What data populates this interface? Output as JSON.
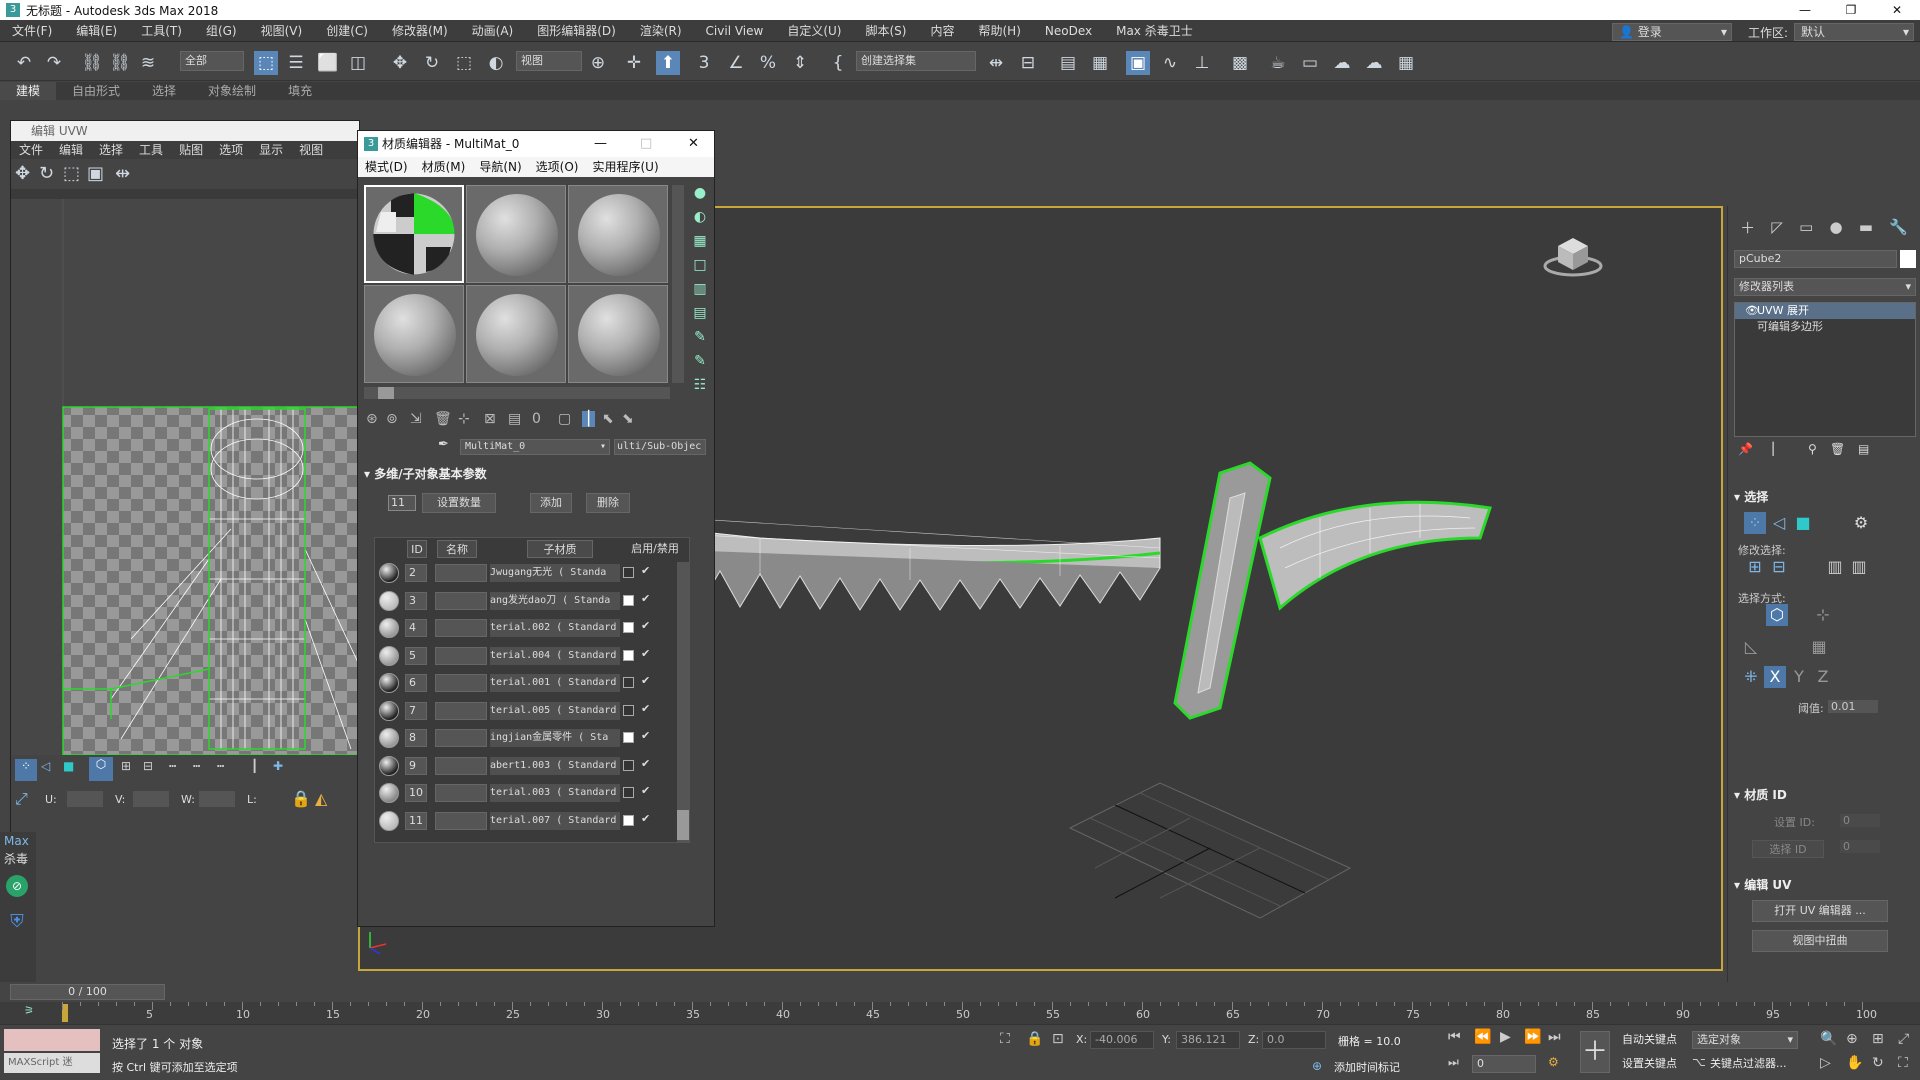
{
  "window": {
    "title": "无标题 - Autodesk 3ds Max 2018",
    "min": "—",
    "max": "❐",
    "close": "✕"
  },
  "menu": [
    "文件(F)",
    "编辑(E)",
    "工具(T)",
    "组(G)",
    "视图(V)",
    "创建(C)",
    "修改器(M)",
    "动画(A)",
    "图形编辑器(D)",
    "渲染(R)",
    "Civil View",
    "自定义(U)",
    "脚本(S)",
    "内容",
    "帮助(H)",
    "NeoDex",
    "Max 杀毒卫士"
  ],
  "login": "登录",
  "workspace": {
    "label": "工作区:",
    "value": "默认"
  },
  "toolbar": {
    "filter": "全部",
    "ref_coord": "视图",
    "named_selection": "创建选择集"
  },
  "ribbon_tabs": [
    "建模",
    "自由形式",
    "选择",
    "对象绘制",
    "填充"
  ],
  "uvw_editor": {
    "title": "编辑 UVW",
    "menu": [
      "文件",
      "编辑",
      "选择",
      "工具",
      "贴图",
      "选项",
      "显示",
      "视图"
    ],
    "u_label": "U:",
    "v_label": "V:",
    "w_label": "W:",
    "l_label": "L:"
  },
  "left_strip": {
    "max_label": "Max",
    "antivirus_label": "杀毒"
  },
  "material_editor": {
    "title": "材质编辑器 - MultiMat_0",
    "menu": [
      "模式(D)",
      "材质(M)",
      "导航(N)",
      "选项(O)",
      "实用程序(U)"
    ],
    "mat_name": "MultiMat_0",
    "mat_type": "ulti/Sub-Objec",
    "rollout_title": "多维/子对象基本参数",
    "count": "11",
    "set_count": "设置数量",
    "add": "添加",
    "delete": "删除",
    "columns": {
      "id": "ID",
      "name": "名称",
      "sub": "子材质",
      "enable": "启用/禁用"
    },
    "rows": [
      {
        "id": "2",
        "sub": "Jwugang无光  ( Standa",
        "ball": "#222",
        "color": "#333"
      },
      {
        "id": "3",
        "sub": "ang发光dao刀  ( Standa",
        "ball": "#bbb",
        "color": "#ffffff"
      },
      {
        "id": "4",
        "sub": "terial.002  ( Standard",
        "ball": "#999",
        "color": "#ffffff"
      },
      {
        "id": "5",
        "sub": "terial.004  ( Standard",
        "ball": "#999",
        "color": "#ffffff"
      },
      {
        "id": "6",
        "sub": "terial.001  ( Standard",
        "ball": "#222",
        "color": "#333"
      },
      {
        "id": "7",
        "sub": "terial.005  ( Standard",
        "ball": "#222",
        "color": "#333"
      },
      {
        "id": "8",
        "sub": "ingjian金属零件  ( Sta",
        "ball": "#999",
        "color": "#ffffff"
      },
      {
        "id": "9",
        "sub": "abert1.003  ( Standard",
        "ball": "#222",
        "color": "#333"
      },
      {
        "id": "10",
        "sub": "terial.003  ( Standard",
        "ball": "#888",
        "color": "#333"
      },
      {
        "id": "11",
        "sub": "terial.007  ( Standard",
        "ball": "#bbb",
        "color": "#ffffff"
      }
    ],
    "check": "✔"
  },
  "command_panel": {
    "object_name": "pCube2",
    "modifier_list": "修改器列表",
    "stack": [
      "UVW 展开",
      "可编辑多边形"
    ],
    "selection_title": "选择",
    "modify_selection": "修改选择:",
    "select_by": "选择方式:",
    "threshold_label": "阈值:",
    "threshold_value": "0.01",
    "matid_title": "材质 ID",
    "set_id": "设置 ID:",
    "set_id_val": "0",
    "select_id": "选择 ID",
    "select_id_val": "0",
    "edit_uv_title": "编辑 UV",
    "open_uv_editor": "打开 UV 编辑器 ...",
    "tweak_in_view": "视图中扭曲",
    "axis_x": "X",
    "axis_y": "Y",
    "axis_z": "Z"
  },
  "timeline": {
    "frame": "0 / 100",
    "ticks": [
      "5",
      "10",
      "15",
      "20",
      "25",
      "30",
      "35",
      "40",
      "45",
      "50",
      "55",
      "60",
      "65",
      "70",
      "75",
      "80",
      "85",
      "90",
      "95",
      "100"
    ]
  },
  "status": {
    "maxscript": "MAXScript 迷",
    "selected": "选择了 1 个 对象",
    "hint": "按 Ctrl 键可添加至选定项",
    "x_label": "X:",
    "x_val": "-40.006",
    "y_label": "Y:",
    "y_val": "386.121",
    "z_label": "Z:",
    "z_val": "0.0",
    "grid": "栅格 = 10.0",
    "add_time_tag": "添加时间标记",
    "auto_key": "自动关键点",
    "set_key": "设置关键点",
    "selected_obj": "选定对象",
    "key_filters": "关键点过滤器...",
    "frame_val": "0"
  }
}
